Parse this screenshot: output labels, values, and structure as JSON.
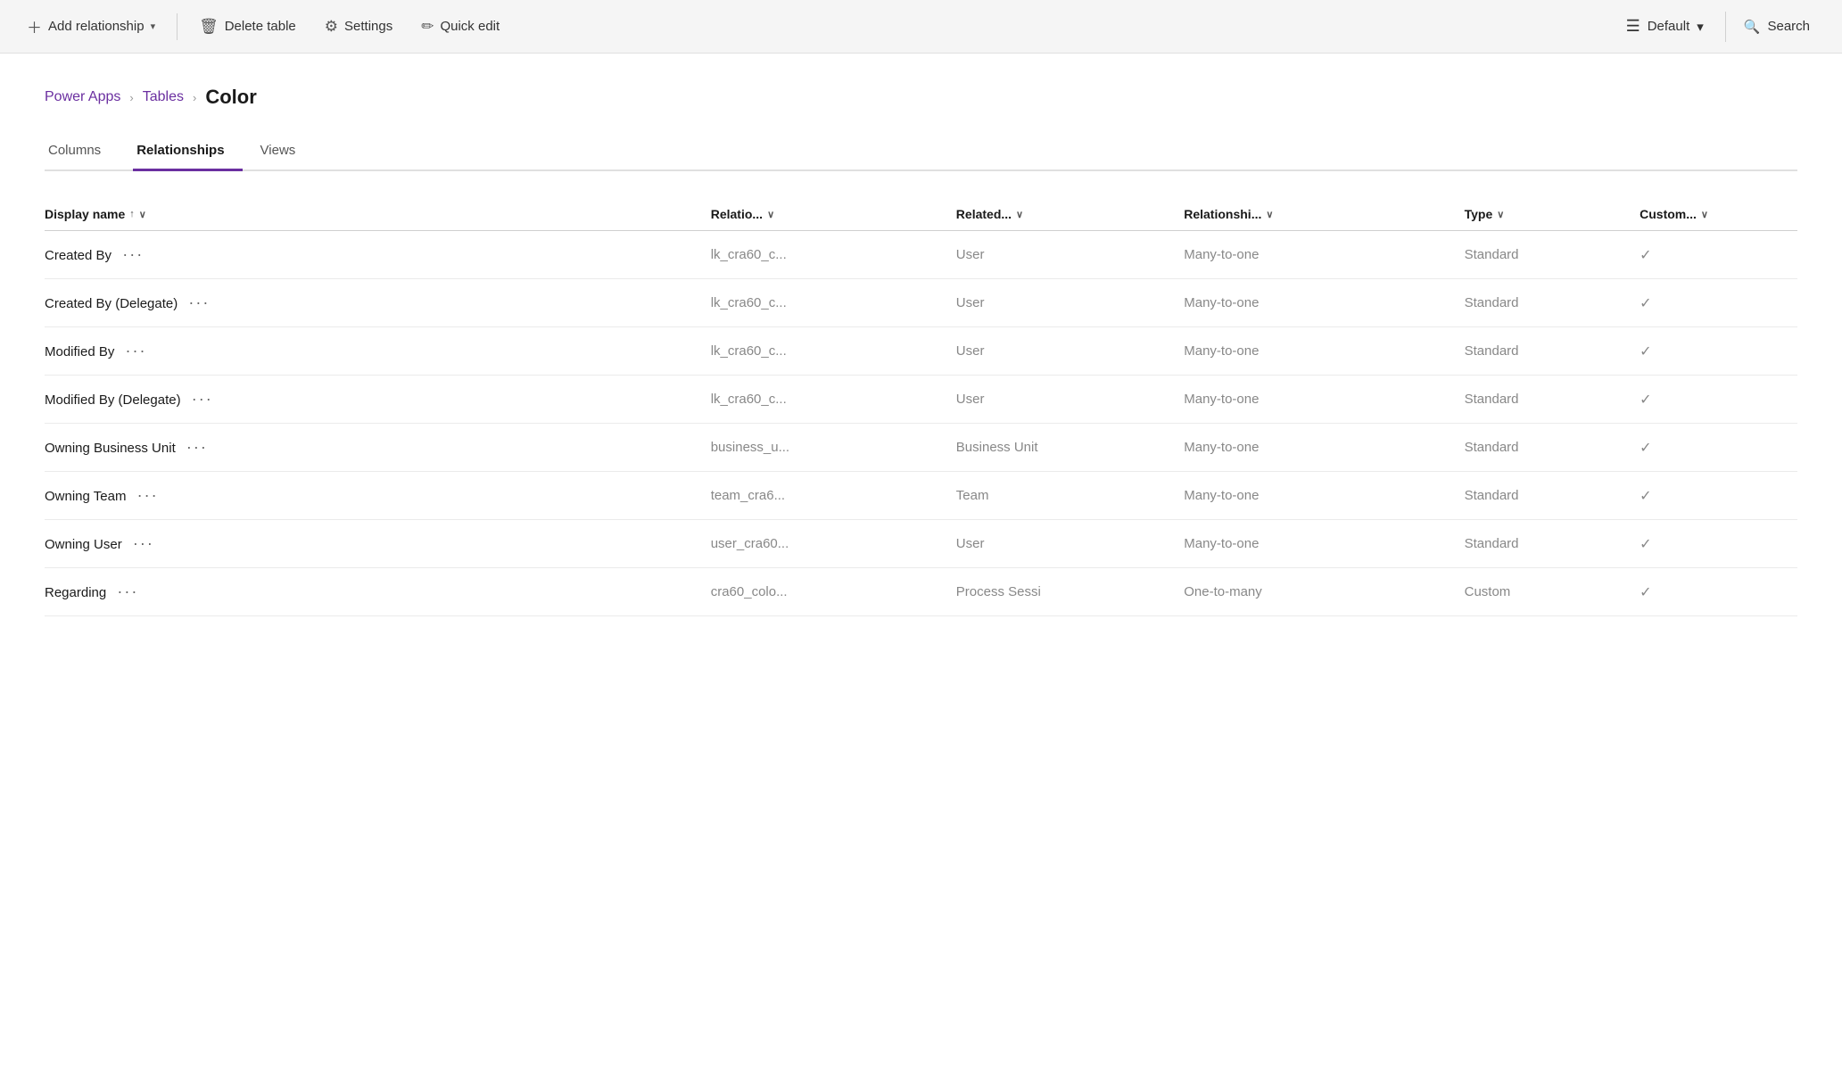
{
  "toolbar": {
    "add_relationship_label": "Add relationship",
    "delete_table_label": "Delete table",
    "settings_label": "Settings",
    "quick_edit_label": "Quick edit",
    "default_label": "Default",
    "search_label": "Search"
  },
  "breadcrumb": {
    "power_apps": "Power Apps",
    "tables": "Tables",
    "current": "Color"
  },
  "tabs": [
    {
      "id": "columns",
      "label": "Columns",
      "active": false
    },
    {
      "id": "relationships",
      "label": "Relationships",
      "active": true
    },
    {
      "id": "views",
      "label": "Views",
      "active": false
    }
  ],
  "table": {
    "columns": [
      {
        "id": "display_name",
        "label": "Display name",
        "sort": "↑",
        "filter": true
      },
      {
        "id": "relationship",
        "label": "Relatio...",
        "filter": true
      },
      {
        "id": "related",
        "label": "Related...",
        "filter": true
      },
      {
        "id": "relationship_type",
        "label": "Relationshi...",
        "filter": true
      },
      {
        "id": "type",
        "label": "Type",
        "filter": true
      },
      {
        "id": "custom",
        "label": "Custom...",
        "filter": true
      }
    ],
    "rows": [
      {
        "display_name": "Created By",
        "relationship": "lk_cra60_c...",
        "related": "User",
        "relationship_type": "Many-to-one",
        "type": "Standard",
        "custom": true
      },
      {
        "display_name": "Created By (Delegate)",
        "relationship": "lk_cra60_c...",
        "related": "User",
        "relationship_type": "Many-to-one",
        "type": "Standard",
        "custom": true
      },
      {
        "display_name": "Modified By",
        "relationship": "lk_cra60_c...",
        "related": "User",
        "relationship_type": "Many-to-one",
        "type": "Standard",
        "custom": true
      },
      {
        "display_name": "Modified By (Delegate)",
        "relationship": "lk_cra60_c...",
        "related": "User",
        "relationship_type": "Many-to-one",
        "type": "Standard",
        "custom": true
      },
      {
        "display_name": "Owning Business Unit",
        "relationship": "business_u...",
        "related": "Business Unit",
        "relationship_type": "Many-to-one",
        "type": "Standard",
        "custom": true
      },
      {
        "display_name": "Owning Team",
        "relationship": "team_cra6...",
        "related": "Team",
        "relationship_type": "Many-to-one",
        "type": "Standard",
        "custom": true
      },
      {
        "display_name": "Owning User",
        "relationship": "user_cra60...",
        "related": "User",
        "relationship_type": "Many-to-one",
        "type": "Standard",
        "custom": true
      },
      {
        "display_name": "Regarding",
        "relationship": "cra60_colo...",
        "related": "Process Sessi",
        "relationship_type": "One-to-many",
        "type": "Custom",
        "custom": true
      }
    ]
  }
}
